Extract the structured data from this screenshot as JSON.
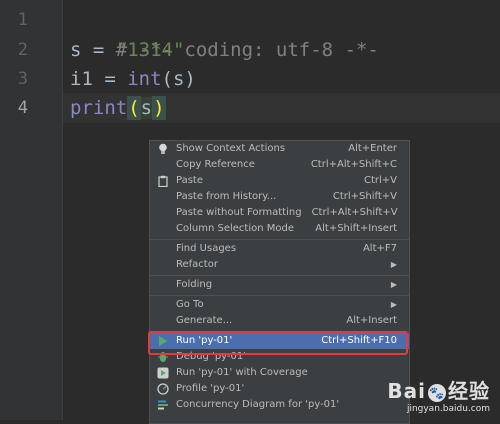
{
  "editor": {
    "line_numbers": [
      "1",
      "2",
      "3",
      "4"
    ],
    "lines": [
      {
        "comment": "# -*- coding: utf-8 -*-"
      },
      {
        "var": "s",
        "op": " = ",
        "string": "\"1314\""
      },
      {
        "var": "i1",
        "op": " = ",
        "builtin": "int",
        "args": "(s)"
      },
      {
        "builtin": "print",
        "paren_open": "(",
        "arg": "s",
        "paren_close": ")"
      }
    ]
  },
  "context_menu": {
    "items": [
      {
        "label": "Show Context Actions",
        "shortcut": "Alt+Enter",
        "icon": "lightbulb-icon"
      },
      {
        "label": "Copy Reference",
        "shortcut": "Ctrl+Alt+Shift+C"
      },
      {
        "label": "Paste",
        "shortcut": "Ctrl+V",
        "icon": "clipboard-icon"
      },
      {
        "label": "Paste from History...",
        "shortcut": "Ctrl+Shift+V"
      },
      {
        "label": "Paste without Formatting",
        "shortcut": "Ctrl+Alt+Shift+V"
      },
      {
        "label": "Column Selection Mode",
        "shortcut": "Alt+Shift+Insert"
      },
      {
        "label": "Find Usages",
        "shortcut": "Alt+F7"
      },
      {
        "label": "Refactor",
        "submenu": true
      },
      {
        "label": "Folding",
        "submenu": true
      },
      {
        "label": "Go To",
        "submenu": true
      },
      {
        "label": "Generate...",
        "shortcut": "Alt+Insert"
      },
      {
        "label": "Run 'py-01'",
        "shortcut": "Ctrl+Shift+F10",
        "icon": "run-icon",
        "selected": true
      },
      {
        "label": "Debug 'py-01'",
        "icon": "debug-bug-icon"
      },
      {
        "label": "Run 'py-01' with Coverage",
        "icon": "coverage-icon"
      },
      {
        "label": "Profile 'py-01'",
        "icon": "profile-icon"
      },
      {
        "label": "Concurrency Diagram for 'py-01'",
        "icon": "concurrency-icon"
      }
    ]
  },
  "watermark": {
    "brand": "Bai",
    "brand_suffix": "经验",
    "url": "jingyan.baidu.com"
  },
  "colors": {
    "selection": "#4b6eaf",
    "highlight_box": "#e23b3b",
    "background": "#2b2b2b"
  }
}
